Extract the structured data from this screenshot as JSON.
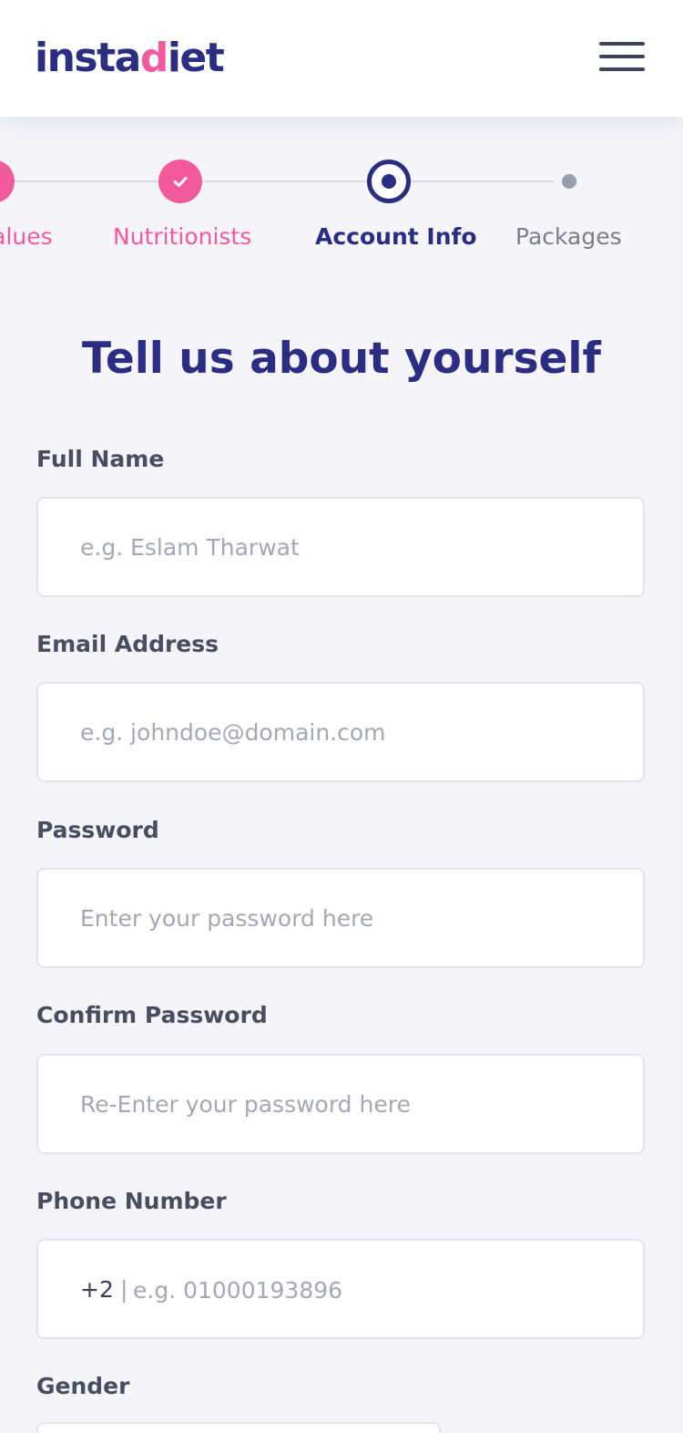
{
  "header": {
    "logo_prefix": "insta",
    "logo_mid": "d",
    "logo_suffix": "iet",
    "menu_icon": "hamburger-menu-icon"
  },
  "stepper": {
    "steps": [
      {
        "label": "Values",
        "state": "done"
      },
      {
        "label": "Nutritionists",
        "state": "done"
      },
      {
        "label": "Account Info",
        "state": "current"
      },
      {
        "label": "Packages",
        "state": "future"
      }
    ],
    "done_icon": "checkmark-icon"
  },
  "form": {
    "title": "Tell us about yourself",
    "full_name": {
      "label": "Full Name",
      "placeholder": "e.g. Eslam Tharwat",
      "value": ""
    },
    "email": {
      "label": "Email Address",
      "placeholder": "e.g. johndoe@domain.com",
      "value": ""
    },
    "password": {
      "label": "Password",
      "placeholder": "Enter your password here",
      "value": ""
    },
    "confirm_password": {
      "label": "Confirm Password",
      "placeholder": "Re-Enter your password here",
      "value": ""
    },
    "phone": {
      "label": "Phone Number",
      "prefix": "+2",
      "separator": "|",
      "placeholder": "e.g. 01000193896",
      "value": ""
    },
    "gender": {
      "label": "Gender"
    }
  },
  "colors": {
    "brand_navy": "#2b2d82",
    "brand_pink": "#f25a9b",
    "background": "#f4f4f9",
    "muted_text": "#7b7d8e"
  }
}
